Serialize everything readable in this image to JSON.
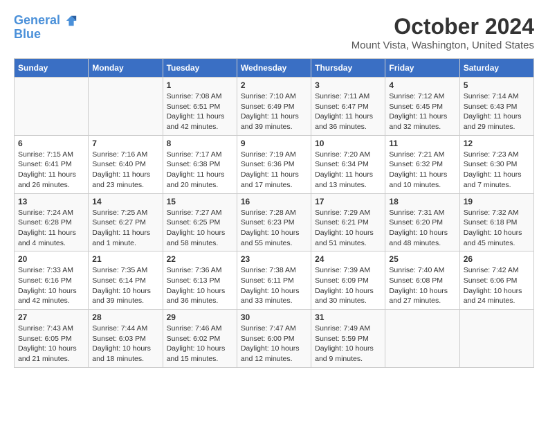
{
  "logo": {
    "line1": "General",
    "line2": "Blue"
  },
  "title": "October 2024",
  "subtitle": "Mount Vista, Washington, United States",
  "days_of_week": [
    "Sunday",
    "Monday",
    "Tuesday",
    "Wednesday",
    "Thursday",
    "Friday",
    "Saturday"
  ],
  "weeks": [
    [
      {
        "day": "",
        "info": ""
      },
      {
        "day": "",
        "info": ""
      },
      {
        "day": "1",
        "info": "Sunrise: 7:08 AM\nSunset: 6:51 PM\nDaylight: 11 hours and 42 minutes."
      },
      {
        "day": "2",
        "info": "Sunrise: 7:10 AM\nSunset: 6:49 PM\nDaylight: 11 hours and 39 minutes."
      },
      {
        "day": "3",
        "info": "Sunrise: 7:11 AM\nSunset: 6:47 PM\nDaylight: 11 hours and 36 minutes."
      },
      {
        "day": "4",
        "info": "Sunrise: 7:12 AM\nSunset: 6:45 PM\nDaylight: 11 hours and 32 minutes."
      },
      {
        "day": "5",
        "info": "Sunrise: 7:14 AM\nSunset: 6:43 PM\nDaylight: 11 hours and 29 minutes."
      }
    ],
    [
      {
        "day": "6",
        "info": "Sunrise: 7:15 AM\nSunset: 6:41 PM\nDaylight: 11 hours and 26 minutes."
      },
      {
        "day": "7",
        "info": "Sunrise: 7:16 AM\nSunset: 6:40 PM\nDaylight: 11 hours and 23 minutes."
      },
      {
        "day": "8",
        "info": "Sunrise: 7:17 AM\nSunset: 6:38 PM\nDaylight: 11 hours and 20 minutes."
      },
      {
        "day": "9",
        "info": "Sunrise: 7:19 AM\nSunset: 6:36 PM\nDaylight: 11 hours and 17 minutes."
      },
      {
        "day": "10",
        "info": "Sunrise: 7:20 AM\nSunset: 6:34 PM\nDaylight: 11 hours and 13 minutes."
      },
      {
        "day": "11",
        "info": "Sunrise: 7:21 AM\nSunset: 6:32 PM\nDaylight: 11 hours and 10 minutes."
      },
      {
        "day": "12",
        "info": "Sunrise: 7:23 AM\nSunset: 6:30 PM\nDaylight: 11 hours and 7 minutes."
      }
    ],
    [
      {
        "day": "13",
        "info": "Sunrise: 7:24 AM\nSunset: 6:28 PM\nDaylight: 11 hours and 4 minutes."
      },
      {
        "day": "14",
        "info": "Sunrise: 7:25 AM\nSunset: 6:27 PM\nDaylight: 11 hours and 1 minute."
      },
      {
        "day": "15",
        "info": "Sunrise: 7:27 AM\nSunset: 6:25 PM\nDaylight: 10 hours and 58 minutes."
      },
      {
        "day": "16",
        "info": "Sunrise: 7:28 AM\nSunset: 6:23 PM\nDaylight: 10 hours and 55 minutes."
      },
      {
        "day": "17",
        "info": "Sunrise: 7:29 AM\nSunset: 6:21 PM\nDaylight: 10 hours and 51 minutes."
      },
      {
        "day": "18",
        "info": "Sunrise: 7:31 AM\nSunset: 6:20 PM\nDaylight: 10 hours and 48 minutes."
      },
      {
        "day": "19",
        "info": "Sunrise: 7:32 AM\nSunset: 6:18 PM\nDaylight: 10 hours and 45 minutes."
      }
    ],
    [
      {
        "day": "20",
        "info": "Sunrise: 7:33 AM\nSunset: 6:16 PM\nDaylight: 10 hours and 42 minutes."
      },
      {
        "day": "21",
        "info": "Sunrise: 7:35 AM\nSunset: 6:14 PM\nDaylight: 10 hours and 39 minutes."
      },
      {
        "day": "22",
        "info": "Sunrise: 7:36 AM\nSunset: 6:13 PM\nDaylight: 10 hours and 36 minutes."
      },
      {
        "day": "23",
        "info": "Sunrise: 7:38 AM\nSunset: 6:11 PM\nDaylight: 10 hours and 33 minutes."
      },
      {
        "day": "24",
        "info": "Sunrise: 7:39 AM\nSunset: 6:09 PM\nDaylight: 10 hours and 30 minutes."
      },
      {
        "day": "25",
        "info": "Sunrise: 7:40 AM\nSunset: 6:08 PM\nDaylight: 10 hours and 27 minutes."
      },
      {
        "day": "26",
        "info": "Sunrise: 7:42 AM\nSunset: 6:06 PM\nDaylight: 10 hours and 24 minutes."
      }
    ],
    [
      {
        "day": "27",
        "info": "Sunrise: 7:43 AM\nSunset: 6:05 PM\nDaylight: 10 hours and 21 minutes."
      },
      {
        "day": "28",
        "info": "Sunrise: 7:44 AM\nSunset: 6:03 PM\nDaylight: 10 hours and 18 minutes."
      },
      {
        "day": "29",
        "info": "Sunrise: 7:46 AM\nSunset: 6:02 PM\nDaylight: 10 hours and 15 minutes."
      },
      {
        "day": "30",
        "info": "Sunrise: 7:47 AM\nSunset: 6:00 PM\nDaylight: 10 hours and 12 minutes."
      },
      {
        "day": "31",
        "info": "Sunrise: 7:49 AM\nSunset: 5:59 PM\nDaylight: 10 hours and 9 minutes."
      },
      {
        "day": "",
        "info": ""
      },
      {
        "day": "",
        "info": ""
      }
    ]
  ]
}
